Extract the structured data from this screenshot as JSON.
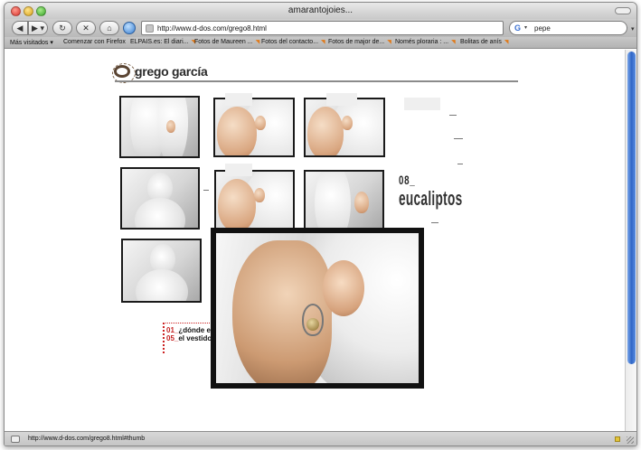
{
  "window": {
    "title": "amarantojoies..."
  },
  "toolbar": {
    "url": "http://www.d-dos.com/grego8.html",
    "search_value": "pepe"
  },
  "bookmarks": [
    "Más visitados",
    "Comenzar con Firefox",
    "ELPAIS.es: El diari...",
    "Fotos de Maureen ...",
    "Fotos del contacto...",
    "Fotos de major de...",
    "Només ploraria : ...",
    "Bolitas de anís"
  ],
  "site": {
    "name": "grego garcía",
    "series_number": "08_",
    "series_name": "eucaliptos",
    "menu": [
      {
        "num": "01_",
        "label": "¿dónde está e"
      },
      {
        "num": "05_",
        "label": "el vestido de"
      }
    ]
  },
  "status": {
    "text": "http://www.d-dos.com/grego8.html#thumb"
  }
}
